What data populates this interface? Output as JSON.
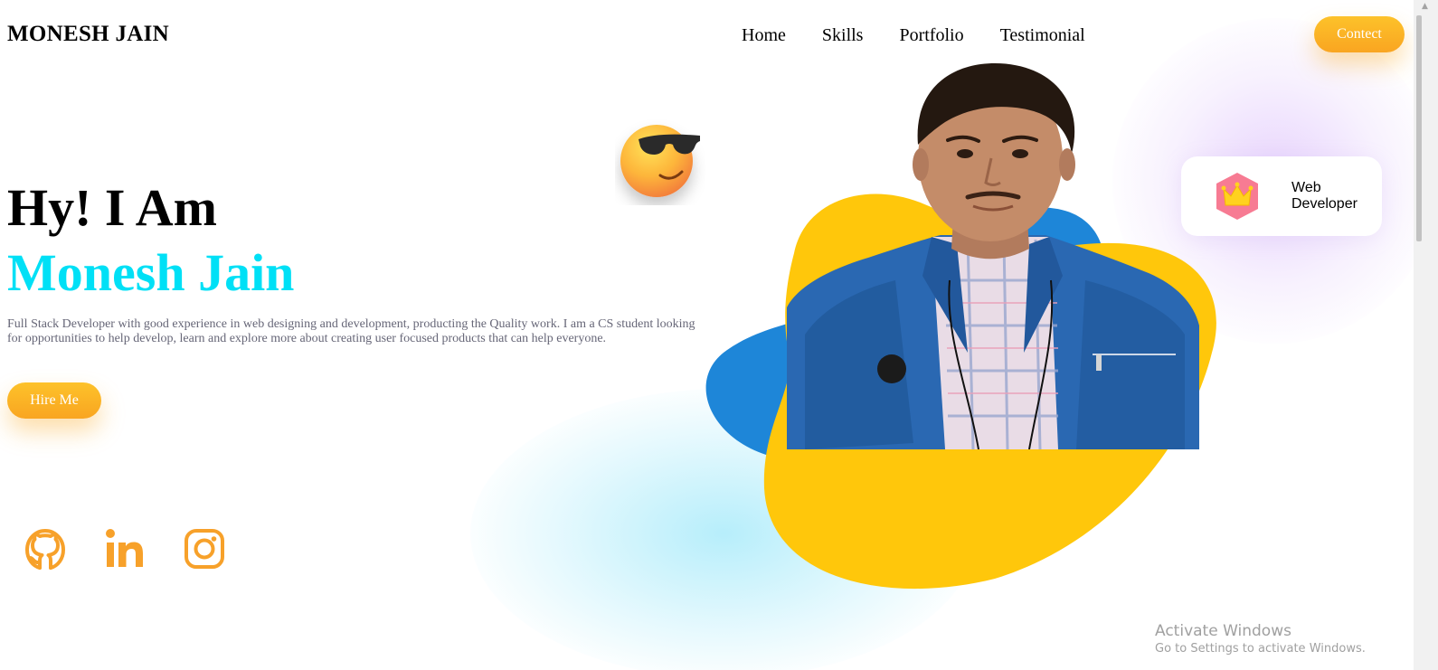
{
  "header": {
    "logo": "MONESH JAIN",
    "nav": [
      "Home",
      "Skills",
      "Portfolio",
      "Testimonial"
    ],
    "contact_label": "Contect"
  },
  "hero": {
    "line1": "Hy! I Am",
    "line2": "Monesh Jain",
    "description": "Full Stack Developer with good experience in web designing and development, producting the Quality work. I am a CS student looking for opportunities to help develop, learn and explore more about creating user focused products that can help everyone.",
    "hire_label": "Hire Me"
  },
  "socials": {
    "icons": [
      "github-icon",
      "linkedin-icon",
      "instagram-icon"
    ]
  },
  "badge": {
    "line1": "Web",
    "line2": "Developer",
    "icon": "crown-icon"
  },
  "watermark": {
    "title": "Activate Windows",
    "subtitle": "Go to Settings to activate Windows."
  },
  "colors": {
    "accent_orange": "#f9a521",
    "accent_cyan": "#00e0f6",
    "blob_yellow": "#ffc70b",
    "blob_blue": "#1e86d8"
  }
}
